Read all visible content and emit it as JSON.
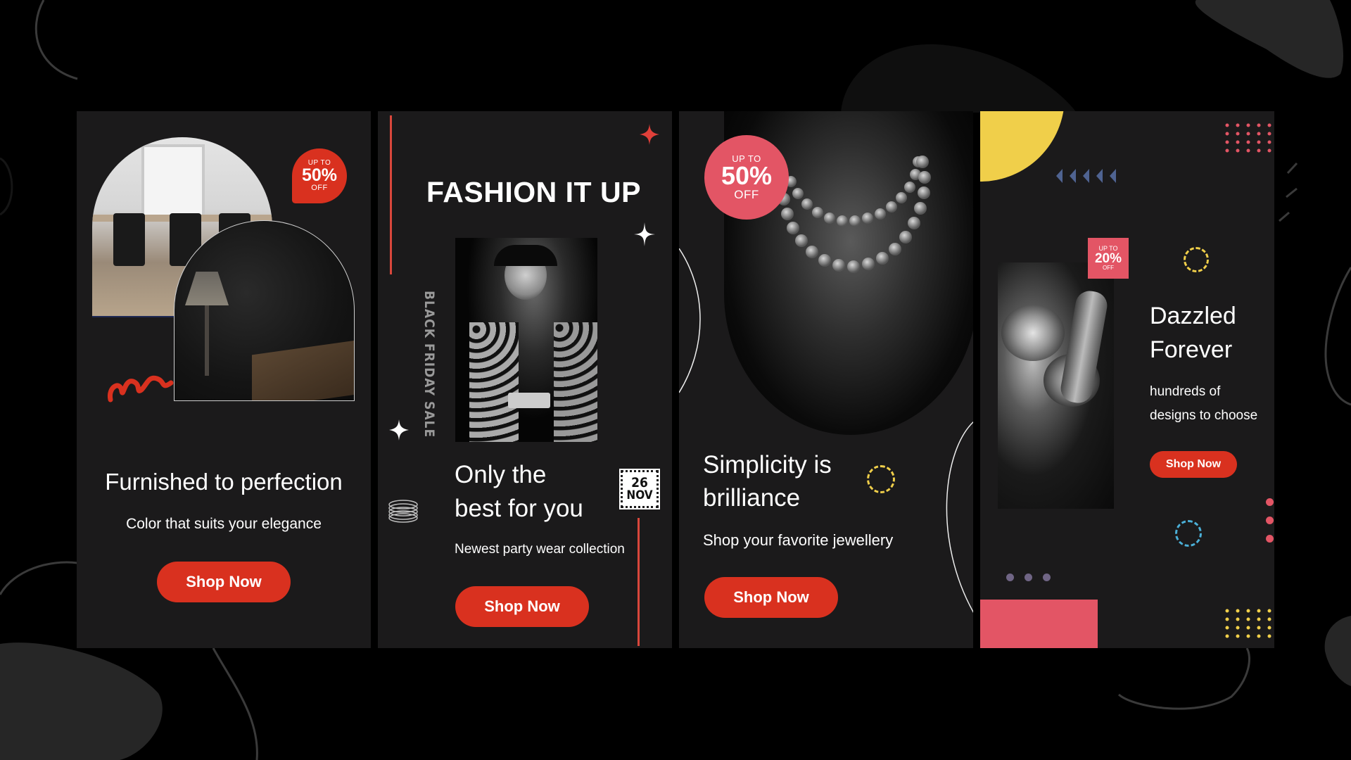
{
  "colors": {
    "background": "#000000",
    "card": "#1b1a1b",
    "accent_red": "#d9311f",
    "accent_pink": "#e35565",
    "accent_yellow": "#f0cf4a",
    "accent_blue": "#4bb0d8",
    "accent_slate": "#4f6391"
  },
  "cards": [
    {
      "badge": {
        "top": "UP TO",
        "value": "50%",
        "bottom": "OFF"
      },
      "title": "Furnished to perfection",
      "subtitle": "Color that suits your elegance",
      "button": "Shop Now",
      "images": [
        "dining-room-photo",
        "lamp-desk-photo"
      ]
    },
    {
      "title": "FASHION IT UP",
      "vertical_label": "BLACK FRIDAY SALE",
      "date_stamp": {
        "day": "26",
        "month": "NOV"
      },
      "headline_line1": "Only the",
      "headline_line2": "best for you",
      "subtitle": "Newest party wear collection",
      "button": "Shop Now",
      "images": [
        "fashion-model-photo"
      ]
    },
    {
      "badge": {
        "top": "UP TO",
        "value": "50%",
        "bottom": "OFF"
      },
      "headline_line1": "Simplicity is",
      "headline_line2": "brilliance",
      "subtitle": "Shop your favorite jewellery",
      "button": "Shop Now",
      "images": [
        "pearl-necklace-photo"
      ]
    },
    {
      "badge": {
        "top": "UP TO",
        "value": "20%",
        "bottom": "OFF"
      },
      "headline_line1": "Dazzled",
      "headline_line2": "Forever",
      "subtitle_line1": "hundreds of",
      "subtitle_line2": "designs to choose",
      "button": "Shop Now",
      "images": [
        "diamond-ring-photo"
      ]
    }
  ]
}
